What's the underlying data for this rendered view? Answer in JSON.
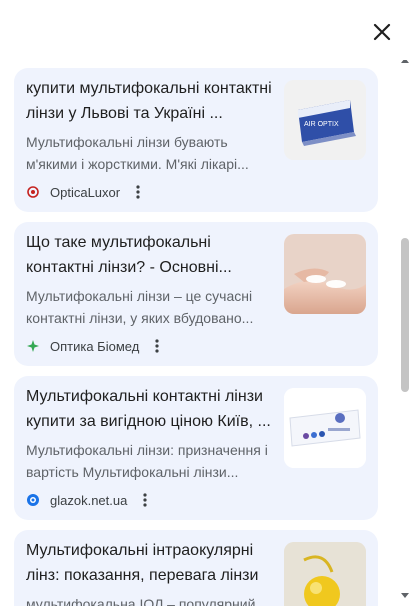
{
  "close": {
    "icon": "close-icon"
  },
  "results": [
    {
      "title": "купити мультифокальні контактні лінзи у Львові та Україні ...",
      "description": "Мультифокальні лінзи бувають м'якими і жорсткими. М'які лікарі...",
      "source": "OpticaLuxor",
      "favicon_color": "#c5221f",
      "thumbnail": "lens-box-product"
    },
    {
      "title": "Що таке мультифокальні контактні лінзи? - Основні...",
      "description": "Мультифокальні лінзи – це сучасні контактні лінзи, у яких вбудовано...",
      "source": "Оптика Біомед",
      "favicon_color": "#34a853",
      "thumbnail": "lenses-on-fingertips"
    },
    {
      "title": "Мультифокальні контактні лінзи купити за вигідною ціною Київ, ...",
      "description": "Мультифокальні лінзи: призначення і вартість Мультифокальні лінзи...",
      "source": "glazok.net.ua",
      "favicon_color": "#1a73e8",
      "thumbnail": "lens-box-blue"
    },
    {
      "title": "Мультифокальні інтраокулярні лінз: показання, перевага лінзи",
      "description": "мультифокальна ІОЛ – популярний",
      "source": "",
      "favicon_color": "#5f6368",
      "thumbnail": "intraocular-lens"
    }
  ],
  "colors": {
    "card_bg": "#eff3fd",
    "title": "#1f1f1f",
    "desc": "#5f6368",
    "scroll_thumb": "#c4c4c4"
  }
}
